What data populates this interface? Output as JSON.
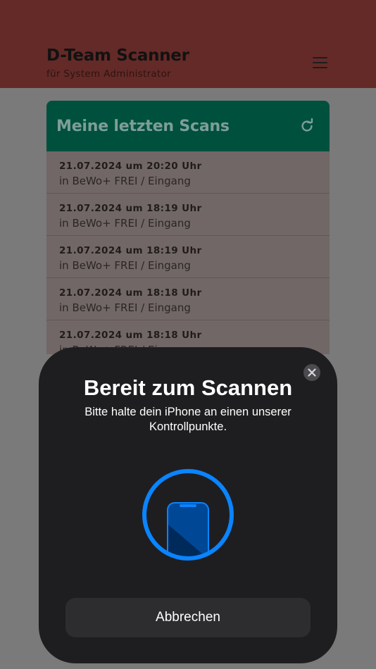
{
  "header": {
    "title": "D-Team Scanner",
    "subtitle": "für System Administrator"
  },
  "scans_card": {
    "title": "Meine letzten Scans",
    "items": [
      {
        "date": "21.07.2024 um 20:20 Uhr",
        "location": "in BeWo+ FREI / Eingang"
      },
      {
        "date": "21.07.2024 um 18:19 Uhr",
        "location": "in BeWo+ FREI / Eingang"
      },
      {
        "date": "21.07.2024 um 18:19 Uhr",
        "location": "in BeWo+ FREI / Eingang"
      },
      {
        "date": "21.07.2024 um 18:18 Uhr",
        "location": "in BeWo+ FREI / Eingang"
      },
      {
        "date": "21.07.2024 um 18:18 Uhr",
        "location": "in BeWo+ FREI / Eingang"
      }
    ]
  },
  "nfc_sheet": {
    "title": "Bereit zum Scannen",
    "message": "Bitte halte dein iPhone an einen unserer Kontrollpunkte.",
    "cancel_label": "Abbrechen"
  },
  "icons": {
    "menu": "hamburger-menu-icon",
    "refresh": "refresh-icon",
    "close": "close-icon",
    "nfc": "iphone-nfc-icon"
  },
  "colors": {
    "header_bg": "#642a27",
    "card_head_bg": "#00503e",
    "sheet_bg": "#1e1e20",
    "accent_blue": "#0a84ff"
  }
}
